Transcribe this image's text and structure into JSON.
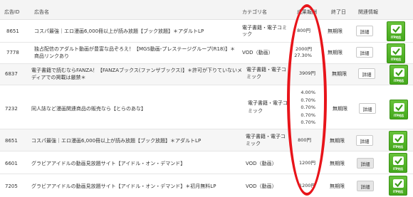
{
  "header": {
    "id": "広告ID",
    "name": "広告名",
    "category": "カテゴリ名",
    "reward": "成果報酬",
    "end_date": "終了日",
    "related": "関連情報"
  },
  "rows": [
    {
      "id": "8651",
      "name_line1": "コスパ最強｜エロ漫画6,000冊以上が読み放題【ブック放題】＊アダルトLP",
      "name_line2": "",
      "category_line1": "電子書籍・電子コミ",
      "category_line2": "ック",
      "reward_lines": [
        "800円"
      ],
      "end": "無期限",
      "detail": "詳細",
      "itp": "ITP対応"
    },
    {
      "id": "7778",
      "name_line1": "独占配信のアダルト動画が豊富な品ぞろえ！【MGS動画-プレステージグループ(R18)】＊",
      "name_line2": "商品リンクあり",
      "category_line1": "VOD（動画）",
      "category_line2": "",
      "reward_lines": [
        "2000円",
        "27.30%"
      ],
      "end": "無期限",
      "detail": "詳細",
      "itp": "ITP対応"
    },
    {
      "id": "6837",
      "name_line1": "電子書籍で読むならFANZA！【FANZAブックス(ファンザブックス)】＊許可が下りていないメ",
      "name_line2": "ディアでの掲載は厳禁＊",
      "category_line1": "電子書籍・電子コ",
      "category_line2": "ミック",
      "reward_lines": [
        "3909円"
      ],
      "end": "無期限",
      "detail": "詳細",
      "itp": "ITP対応"
    },
    {
      "id": "7232",
      "name_line1": "同人誌など漫画関連商品の販売なら【とらのあな】",
      "name_line2": "",
      "category_line1": "電子書籍・電子コ",
      "category_line2": "ミック",
      "reward_lines": [
        "4.00%",
        "0.70%",
        "0.70%",
        "0.70%",
        "0.70%"
      ],
      "end": "無期限",
      "detail": "詳細",
      "itp": "ITP対応"
    },
    {
      "id": "8651",
      "name_line1": "コスパ最強｜エロ漫画6,000冊以上が読み放題【ブック放題】＊アダルトLP",
      "name_line2": "",
      "category_line1": "電子書籍・電子コ",
      "category_line2": "ミック",
      "reward_lines": [
        "800円"
      ],
      "end": "無期限",
      "detail": "詳細",
      "itp": "ITP対応"
    },
    {
      "id": "6601",
      "name_line1": "グラビアアイドルの動画見放題サイト【アイドル・オン・デマンド】",
      "name_line2": "",
      "category_line1": "VOD（動画）",
      "category_line2": "",
      "reward_lines": [
        "1200円"
      ],
      "end": "無期限",
      "detail": "詳細",
      "itp": "ITP対応"
    },
    {
      "id": "7205",
      "name_line1": "グラビアアイドルの動画見放題サイト【アイドル・オン・デマンド】＊初月無料LP",
      "name_line2": "",
      "category_line1": "VOD（動画）",
      "category_line2": "",
      "reward_lines": [
        "1200円"
      ],
      "end": "無期限",
      "detail": "詳細",
      "itp": "ITP対応"
    }
  ],
  "colors": {
    "highlight": "#e8141a",
    "itp_green": "#55b52a"
  }
}
